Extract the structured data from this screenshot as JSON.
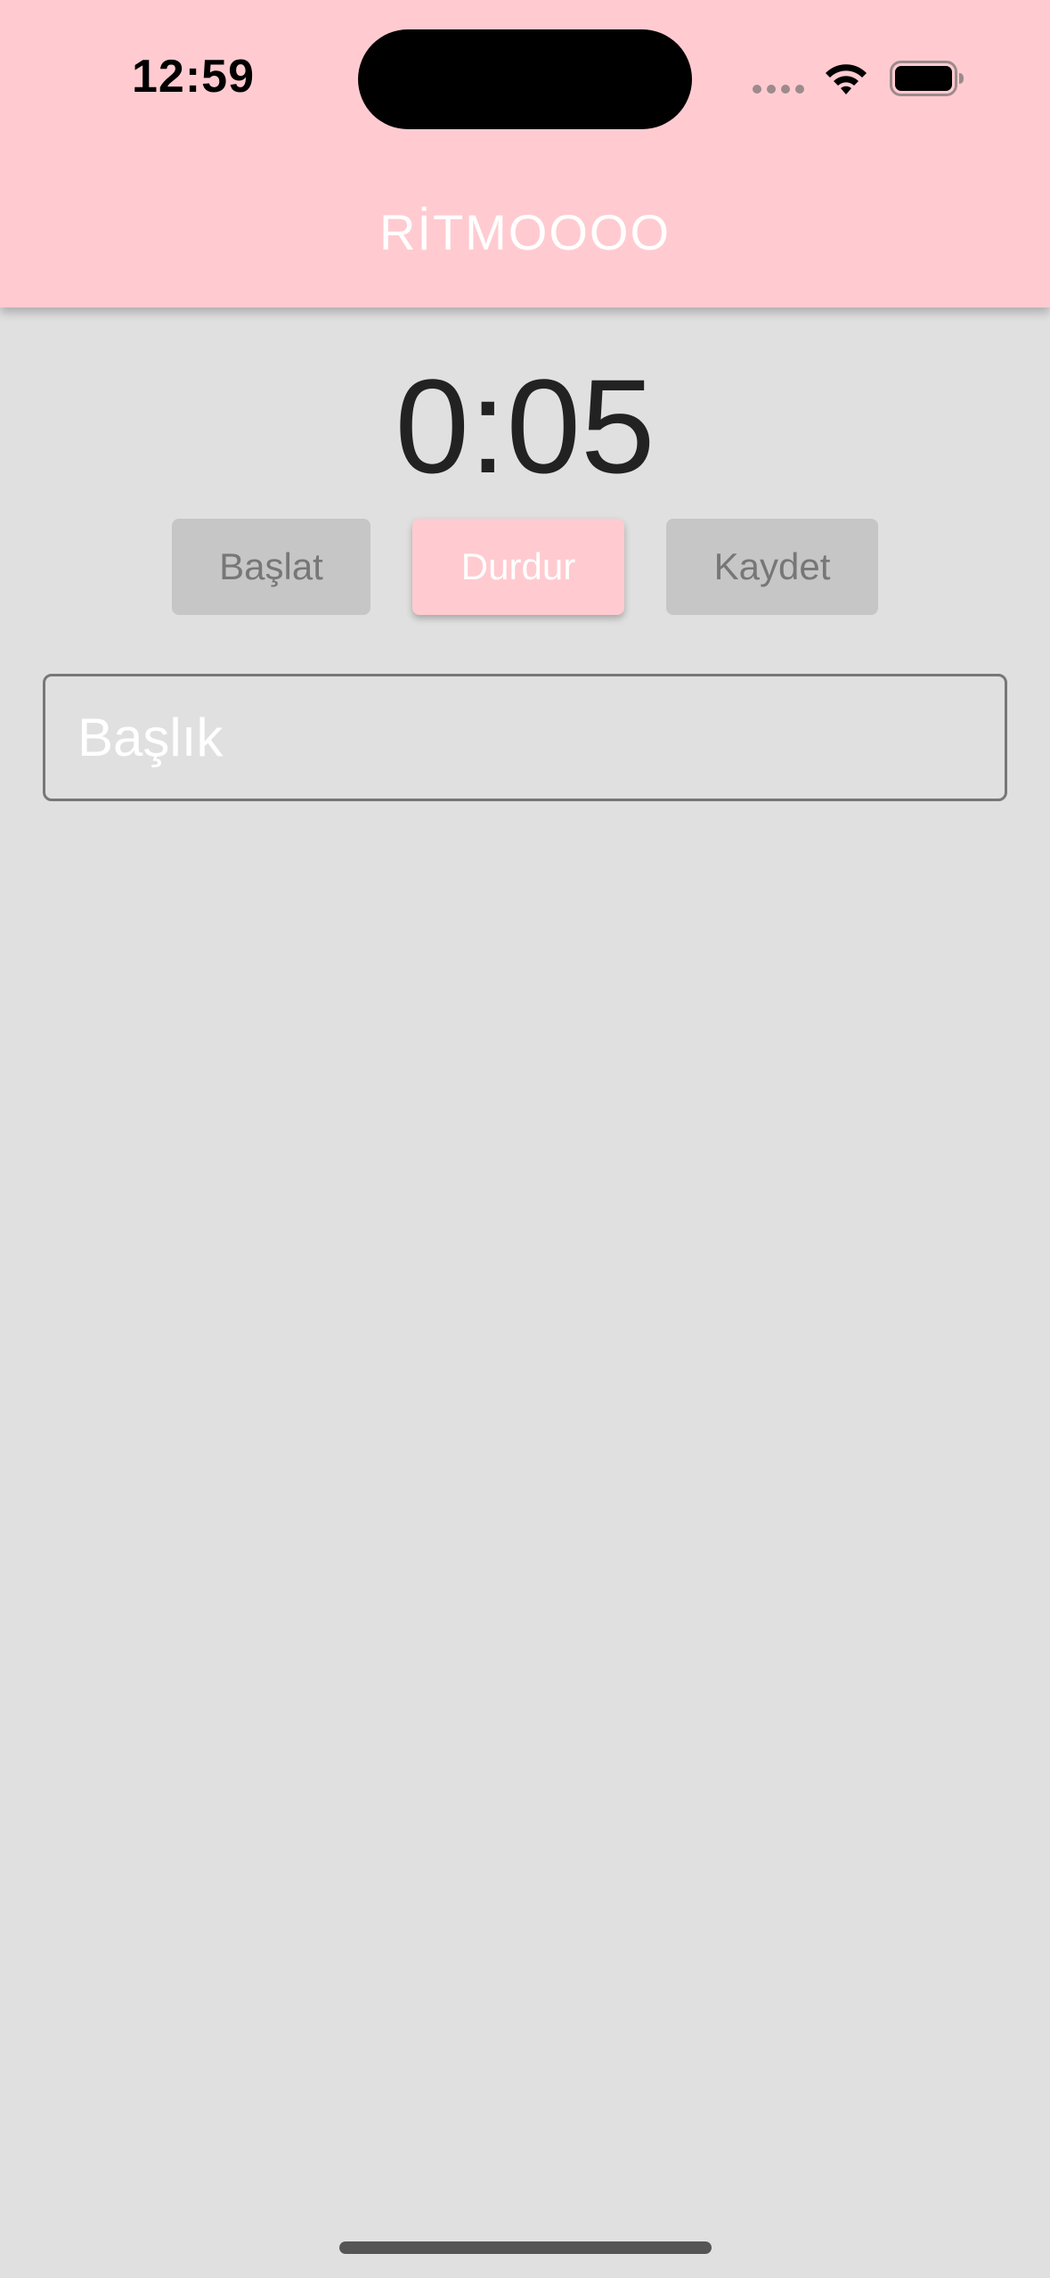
{
  "status_bar": {
    "time": "12:59"
  },
  "app_bar": {
    "title": "RİTMOOOO",
    "background_color": "#ffcbd0"
  },
  "timer": {
    "display": "0:05"
  },
  "controls": {
    "start_label": "Başlat",
    "stop_label": "Durdur",
    "save_label": "Kaydet"
  },
  "title_input": {
    "placeholder": "Başlık",
    "value": ""
  },
  "icons": [
    "wifi-icon",
    "battery-icon",
    "signal-icon"
  ]
}
